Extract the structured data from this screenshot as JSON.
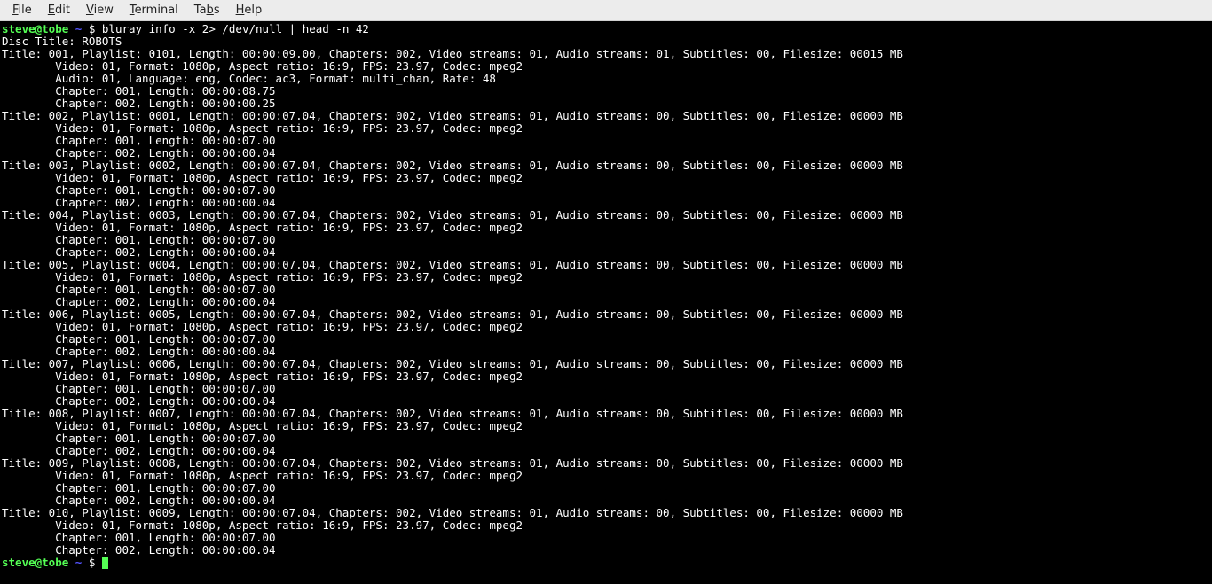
{
  "menu": {
    "file": "File",
    "edit": "Edit",
    "view": "View",
    "terminal": "Terminal",
    "tabs": "Tabs",
    "help": "Help"
  },
  "prompt": {
    "user_host": "steve@tobe",
    "path": "~",
    "dollar": "$"
  },
  "command": "bluray_info -x 2> /dev/null | head -n 42",
  "disc_title_line": "Disc Title: ROBOTS",
  "titles": [
    {
      "header": "Title: 001, Playlist: 0101, Length: 00:00:09.00, Chapters: 002, Video streams: 01, Audio streams: 01, Subtitles: 00, Filesize: 00015 MB",
      "video": "        Video: 01, Format: 1080p, Aspect ratio: 16:9, FPS: 23.97, Codec: mpeg2",
      "audio": "        Audio: 01, Language: eng, Codec: ac3, Format: multi_chan, Rate: 48",
      "ch1": "        Chapter: 001, Length: 00:00:08.75",
      "ch2": "        Chapter: 002, Length: 00:00:00.25"
    },
    {
      "header": "Title: 002, Playlist: 0001, Length: 00:00:07.04, Chapters: 002, Video streams: 01, Audio streams: 00, Subtitles: 00, Filesize: 00000 MB",
      "video": "        Video: 01, Format: 1080p, Aspect ratio: 16:9, FPS: 23.97, Codec: mpeg2",
      "ch1": "        Chapter: 001, Length: 00:00:07.00",
      "ch2": "        Chapter: 002, Length: 00:00:00.04"
    },
    {
      "header": "Title: 003, Playlist: 0002, Length: 00:00:07.04, Chapters: 002, Video streams: 01, Audio streams: 00, Subtitles: 00, Filesize: 00000 MB",
      "video": "        Video: 01, Format: 1080p, Aspect ratio: 16:9, FPS: 23.97, Codec: mpeg2",
      "ch1": "        Chapter: 001, Length: 00:00:07.00",
      "ch2": "        Chapter: 002, Length: 00:00:00.04"
    },
    {
      "header": "Title: 004, Playlist: 0003, Length: 00:00:07.04, Chapters: 002, Video streams: 01, Audio streams: 00, Subtitles: 00, Filesize: 00000 MB",
      "video": "        Video: 01, Format: 1080p, Aspect ratio: 16:9, FPS: 23.97, Codec: mpeg2",
      "ch1": "        Chapter: 001, Length: 00:00:07.00",
      "ch2": "        Chapter: 002, Length: 00:00:00.04"
    },
    {
      "header": "Title: 005, Playlist: 0004, Length: 00:00:07.04, Chapters: 002, Video streams: 01, Audio streams: 00, Subtitles: 00, Filesize: 00000 MB",
      "video": "        Video: 01, Format: 1080p, Aspect ratio: 16:9, FPS: 23.97, Codec: mpeg2",
      "ch1": "        Chapter: 001, Length: 00:00:07.00",
      "ch2": "        Chapter: 002, Length: 00:00:00.04"
    },
    {
      "header": "Title: 006, Playlist: 0005, Length: 00:00:07.04, Chapters: 002, Video streams: 01, Audio streams: 00, Subtitles: 00, Filesize: 00000 MB",
      "video": "        Video: 01, Format: 1080p, Aspect ratio: 16:9, FPS: 23.97, Codec: mpeg2",
      "ch1": "        Chapter: 001, Length: 00:00:07.00",
      "ch2": "        Chapter: 002, Length: 00:00:00.04"
    },
    {
      "header": "Title: 007, Playlist: 0006, Length: 00:00:07.04, Chapters: 002, Video streams: 01, Audio streams: 00, Subtitles: 00, Filesize: 00000 MB",
      "video": "        Video: 01, Format: 1080p, Aspect ratio: 16:9, FPS: 23.97, Codec: mpeg2",
      "ch1": "        Chapter: 001, Length: 00:00:07.00",
      "ch2": "        Chapter: 002, Length: 00:00:00.04"
    },
    {
      "header": "Title: 008, Playlist: 0007, Length: 00:00:07.04, Chapters: 002, Video streams: 01, Audio streams: 00, Subtitles: 00, Filesize: 00000 MB",
      "video": "        Video: 01, Format: 1080p, Aspect ratio: 16:9, FPS: 23.97, Codec: mpeg2",
      "ch1": "        Chapter: 001, Length: 00:00:07.00",
      "ch2": "        Chapter: 002, Length: 00:00:00.04"
    },
    {
      "header": "Title: 009, Playlist: 0008, Length: 00:00:07.04, Chapters: 002, Video streams: 01, Audio streams: 00, Subtitles: 00, Filesize: 00000 MB",
      "video": "        Video: 01, Format: 1080p, Aspect ratio: 16:9, FPS: 23.97, Codec: mpeg2",
      "ch1": "        Chapter: 001, Length: 00:00:07.00",
      "ch2": "        Chapter: 002, Length: 00:00:00.04"
    },
    {
      "header": "Title: 010, Playlist: 0009, Length: 00:00:07.04, Chapters: 002, Video streams: 01, Audio streams: 00, Subtitles: 00, Filesize: 00000 MB",
      "video": "        Video: 01, Format: 1080p, Aspect ratio: 16:9, FPS: 23.97, Codec: mpeg2",
      "ch1": "        Chapter: 001, Length: 00:00:07.00",
      "ch2": "        Chapter: 002, Length: 00:00:00.04"
    }
  ]
}
